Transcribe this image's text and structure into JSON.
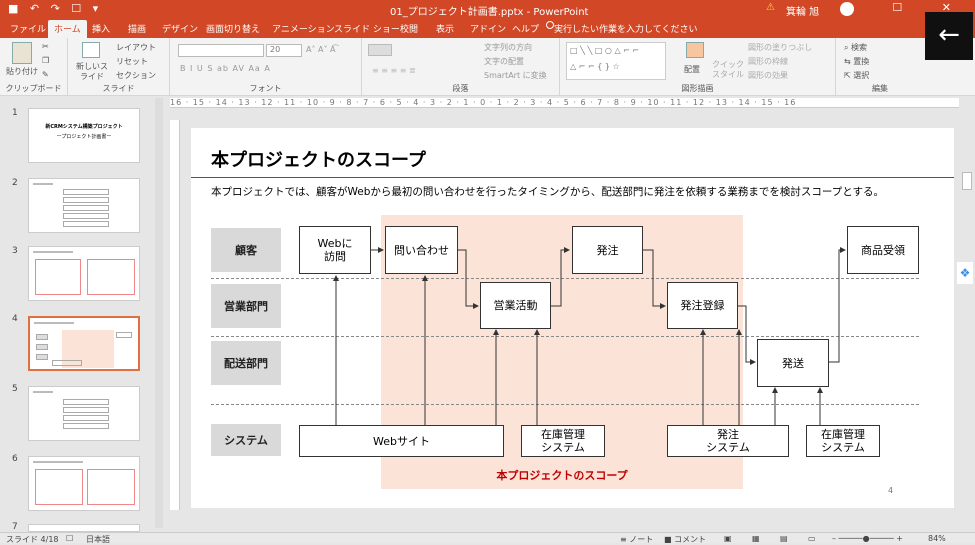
{
  "window": {
    "quick_access": "■ ↶ ↷ ☐ ▾",
    "document_title": "01_プロジェクト計画書.pptx - PowerPoint",
    "warning": "⚠",
    "user_name": "箕輪 旭",
    "window_buttons": "– ☐ ✕"
  },
  "tabs": [
    "ファイル",
    "ホーム",
    "挿入",
    "描画",
    "デザイン",
    "画面切り替え",
    "アニメーション",
    "スライド ショー",
    "校閲",
    "表示",
    "アドイン",
    "ヘルプ"
  ],
  "tell_me": "実行したい作業を入力してください",
  "ribbon": {
    "clipboard": {
      "paste": "貼り付け",
      "label": "クリップボード"
    },
    "slides": {
      "new_slide": "新しいスライド",
      "layout": "レイアウト",
      "reset": "リセット",
      "section": "セクション",
      "label": "スライド"
    },
    "font": {
      "size": "20",
      "format_row": "B  I  U  S  ab  AV  Aa  A",
      "label": "フォント"
    },
    "paragraph": {
      "direction": "文字列の方向",
      "align": "文字の配置",
      "smartart": "SmartArt に変換",
      "label": "段落"
    },
    "drawing": {
      "arrange": "配置",
      "quick_style": "クイックスタイル",
      "fill": "図形の塗りつぶし",
      "outline": "図形の枠線",
      "effect": "図形の効果",
      "label": "図形描画"
    },
    "editing": {
      "find": "検索",
      "replace": "置換",
      "select": "選択",
      "label": "編集"
    }
  },
  "ruler_text": "16 · 15 · 14 · 13 · 12 · 11 · 10 · 9 · 8 · 7 · 6 · 5 · 4 · 3 · 2 · 1 · 0 · 1 · 2 · 3 · 4 · 5 · 6 · 7 · 8 · 9 · 10 · 11 · 12 · 13 · 14 · 15 · 16",
  "thumbnails": [
    {
      "num": "1",
      "title": "新CRMシステム構築プロジェクト",
      "subtitle": "ープロジェクト計画書ー"
    },
    {
      "num": "2"
    },
    {
      "num": "3"
    },
    {
      "num": "4"
    },
    {
      "num": "5"
    },
    {
      "num": "6"
    },
    {
      "num": "7"
    }
  ],
  "slide": {
    "title": "本プロジェクトのスコープ",
    "description": "本プロジェクトでは、顧客がWebから最初の問い合わせを行ったタイミングから、配送部門に発注を依頼する業務までを検討スコープとする。",
    "lanes": {
      "customer": "顧客",
      "sales": "営業部門",
      "delivery": "配送部門",
      "system": "システム"
    },
    "boxes": {
      "web_visit_1": "Webに",
      "web_visit_2": "訪問",
      "inquiry": "問い合わせ",
      "order": "発注",
      "receive": "商品受領",
      "sales_activity": "営業活動",
      "order_register": "発注登録",
      "ship": "発送",
      "website": "Webサイト",
      "inventory_1a": "在庫管理",
      "inventory_1b": "システム",
      "order_sys_a": "発注",
      "order_sys_b": "システム",
      "inventory_2a": "在庫管理",
      "inventory_2b": "システム"
    },
    "scope_label": "本プロジェクトのスコープ",
    "page_number": "4"
  },
  "statusbar": {
    "slide_counter": "スライド 4/18",
    "language": "日本語",
    "notes": "≡ ノート",
    "comments": "■ コメント",
    "zoom": "84%"
  },
  "colors": {
    "accent": "#d24726",
    "scope_fill": "#fbe3d8",
    "scope_text": "#c00000",
    "lane_fill": "#d9d9d9"
  }
}
